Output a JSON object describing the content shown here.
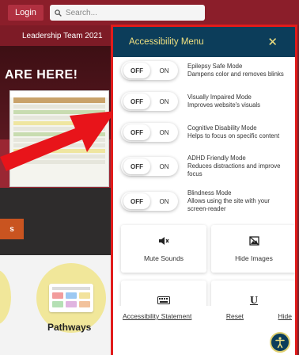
{
  "header": {
    "login_label": "Login",
    "search_placeholder": "Search..."
  },
  "background": {
    "team_title": "Leadership Team 2021",
    "hero_text": "ARE HERE!",
    "orange_chip": "s",
    "pathways_label": "Pathways"
  },
  "accessibility_menu": {
    "title": "Accessibility Menu",
    "close_icon": "close-icon",
    "modes": [
      {
        "title": "Epilepsy Safe Mode",
        "desc": "Dampens color and removes blinks",
        "off": "OFF",
        "on": "ON"
      },
      {
        "title": "Visually Impaired Mode",
        "desc": "Improves website's visuals",
        "off": "OFF",
        "on": "ON"
      },
      {
        "title": "Cognitive Disability Mode",
        "desc": "Helps to focus on specific content",
        "off": "OFF",
        "on": "ON"
      },
      {
        "title": "ADHD Friendly Mode",
        "desc": "Reduces distractions and improve focus",
        "off": "OFF",
        "on": "ON"
      },
      {
        "title": "Blindness Mode",
        "desc": "Allows using the site with your screen-reader",
        "off": "OFF",
        "on": "ON"
      }
    ],
    "tiles": [
      {
        "label": "Mute Sounds",
        "icon": "mute-icon"
      },
      {
        "label": "Hide Images",
        "icon": "hide-image-icon"
      },
      {
        "label": "",
        "icon": "keyboard-icon"
      },
      {
        "label": "",
        "icon": "underline-icon"
      }
    ],
    "footer": {
      "statement": "Accessibility Statement",
      "reset": "Reset",
      "hide": "Hide"
    }
  },
  "colors": {
    "panel_header": "#0c3d5a",
    "panel_header_text": "#f0e080",
    "highlight_border": "#e11b1b",
    "brand": "#8b1e2a"
  }
}
